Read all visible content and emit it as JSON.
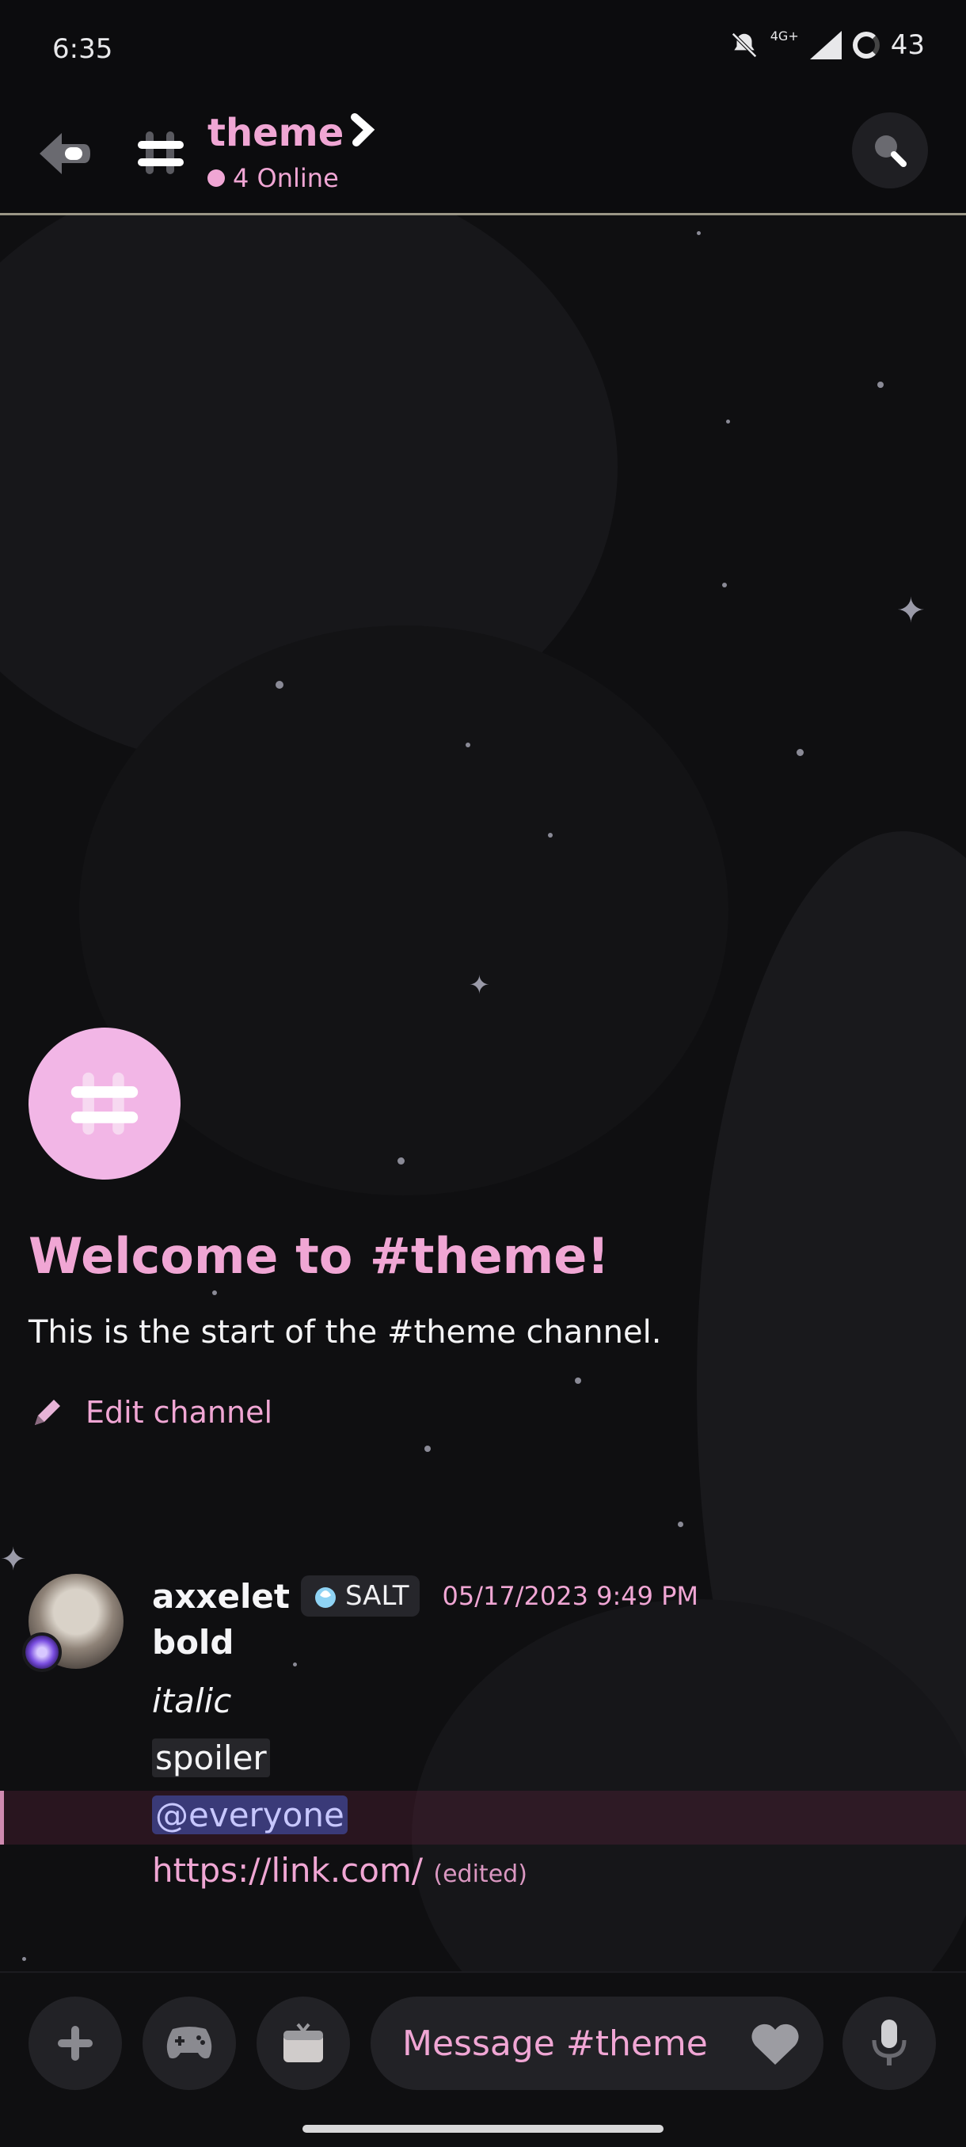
{
  "status_bar": {
    "time": "6:35",
    "network": "4G+",
    "battery": "43"
  },
  "header": {
    "channel_name": "theme",
    "online_count": "4 Online"
  },
  "welcome": {
    "title": "Welcome to #theme!",
    "subtitle": "This is the start of the #theme channel.",
    "edit_label": "Edit channel"
  },
  "message": {
    "username": "axxelet",
    "tag_label": "SALT",
    "timestamp": "05/17/2023 9:49 PM",
    "lines": {
      "bold": "bold",
      "italic": "italic",
      "spoiler": "spoiler",
      "mention": "@everyone",
      "link": "https://link.com/",
      "edited": "(edited)"
    }
  },
  "composer": {
    "placeholder": "Message #theme"
  },
  "colors": {
    "accent": "#f0a6d4",
    "background": "#0f0f11",
    "mention_bg": "#3a3a78"
  },
  "icons": [
    "back-arrow-icon",
    "hash-icon",
    "chevron-right-icon",
    "search-icon",
    "pencil-icon",
    "plus-icon",
    "gamepad-icon",
    "gift-icon",
    "heart-icon",
    "microphone-icon"
  ]
}
